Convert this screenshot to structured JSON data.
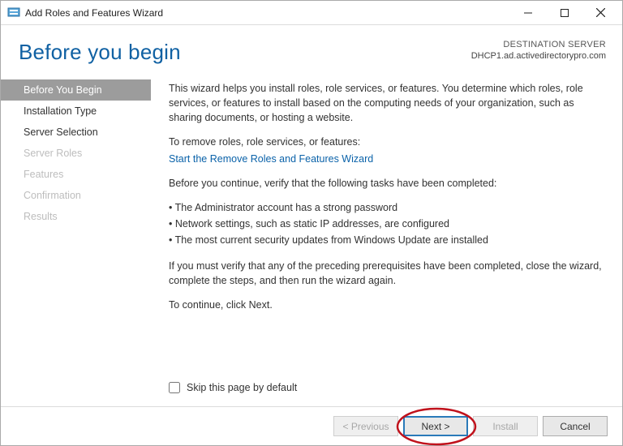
{
  "titlebar": {
    "title": "Add Roles and Features Wizard"
  },
  "header": {
    "heading": "Before you begin",
    "dest_label": "DESTINATION SERVER",
    "dest_server": "DHCP1.ad.activedirectorypro.com"
  },
  "sidebar": {
    "items": [
      {
        "label": "Before You Begin",
        "state": "active"
      },
      {
        "label": "Installation Type",
        "state": "enabled"
      },
      {
        "label": "Server Selection",
        "state": "enabled"
      },
      {
        "label": "Server Roles",
        "state": "disabled"
      },
      {
        "label": "Features",
        "state": "disabled"
      },
      {
        "label": "Confirmation",
        "state": "disabled"
      },
      {
        "label": "Results",
        "state": "disabled"
      }
    ]
  },
  "content": {
    "intro": "This wizard helps you install roles, role services, or features. You determine which roles, role services, or features to install based on the computing needs of your organization, such as sharing documents, or hosting a website.",
    "remove_label": "To remove roles, role services, or features:",
    "remove_link": "Start the Remove Roles and Features Wizard",
    "verify_intro": "Before you continue, verify that the following tasks have been completed:",
    "bullets": [
      "The Administrator account has a strong password",
      "Network settings, such as static IP addresses, are configured",
      "The most current security updates from Windows Update are installed"
    ],
    "close_note": "If you must verify that any of the preceding prerequisites have been completed, close the wizard, complete the steps, and then run the wizard again.",
    "continue_note": "To continue, click Next.",
    "skip_label": "Skip this page by default"
  },
  "footer": {
    "previous": "< Previous",
    "next": "Next >",
    "install": "Install",
    "cancel": "Cancel"
  }
}
